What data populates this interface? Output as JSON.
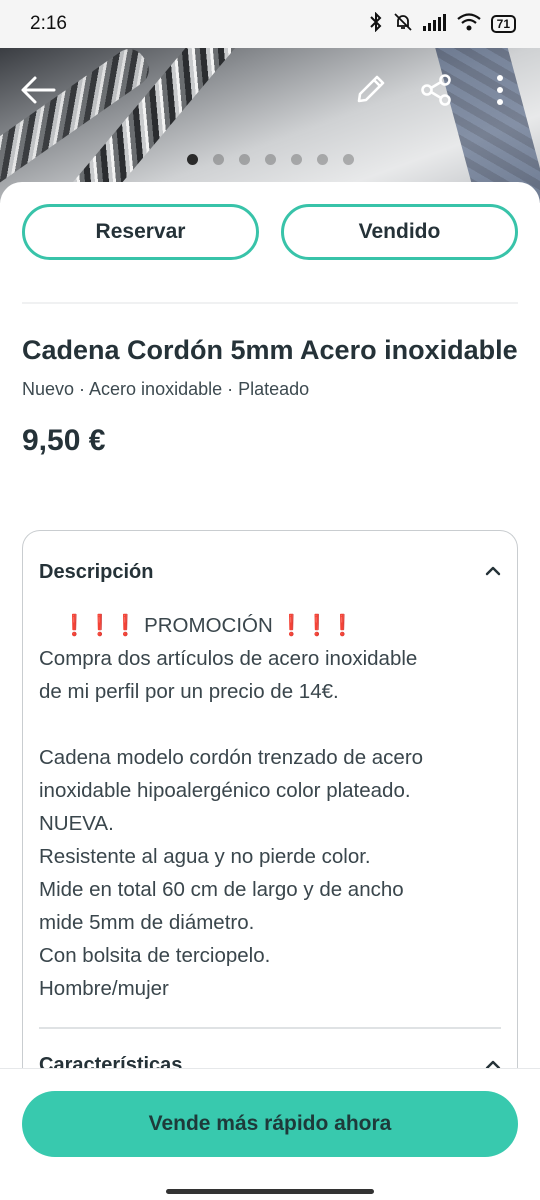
{
  "status": {
    "time": "2:16",
    "battery": "71",
    "icons": [
      "bluetooth-icon",
      "mute-icon",
      "signal-icon",
      "wifi-icon",
      "battery-icon"
    ]
  },
  "toolbar": {
    "back_icon": "arrow-left-icon",
    "edit_icon": "pencil-icon",
    "share_icon": "share-icon",
    "more_icon": "more-vertical-icon"
  },
  "carousel": {
    "count": 7,
    "active": 1
  },
  "actions": {
    "reserve": "Reservar",
    "sold": "Vendido"
  },
  "item": {
    "title": "Cadena Cordón 5mm Acero inoxidable",
    "subtitle": "Nuevo · Acero inoxidable  · Plateado",
    "price": "9,50 €"
  },
  "description": {
    "title": "Descripción",
    "promo_marks": "❗❗❗",
    "promo_text": "PROMOCIÓN",
    "lines": [
      "Compra dos artículos de acero inoxidable",
      "de mi perfil por un precio de 14€.",
      "",
      "Cadena modelo cordón trenzado de acero",
      "inoxidable hipoalergénico color plateado.",
      "NUEVA.",
      "Resistente al agua y no pierde color.",
      "Mide en total 60 cm de largo y de ancho",
      "mide 5mm de diámetro.",
      "Con bolsita de terciopelo.",
      "Hombre/mujer"
    ]
  },
  "features": {
    "title": "Características"
  },
  "cta": {
    "label": "Vende más rápido ahora"
  },
  "colors": {
    "accent": "#38c9ae",
    "text": "#253238",
    "promo": "#e53935"
  }
}
